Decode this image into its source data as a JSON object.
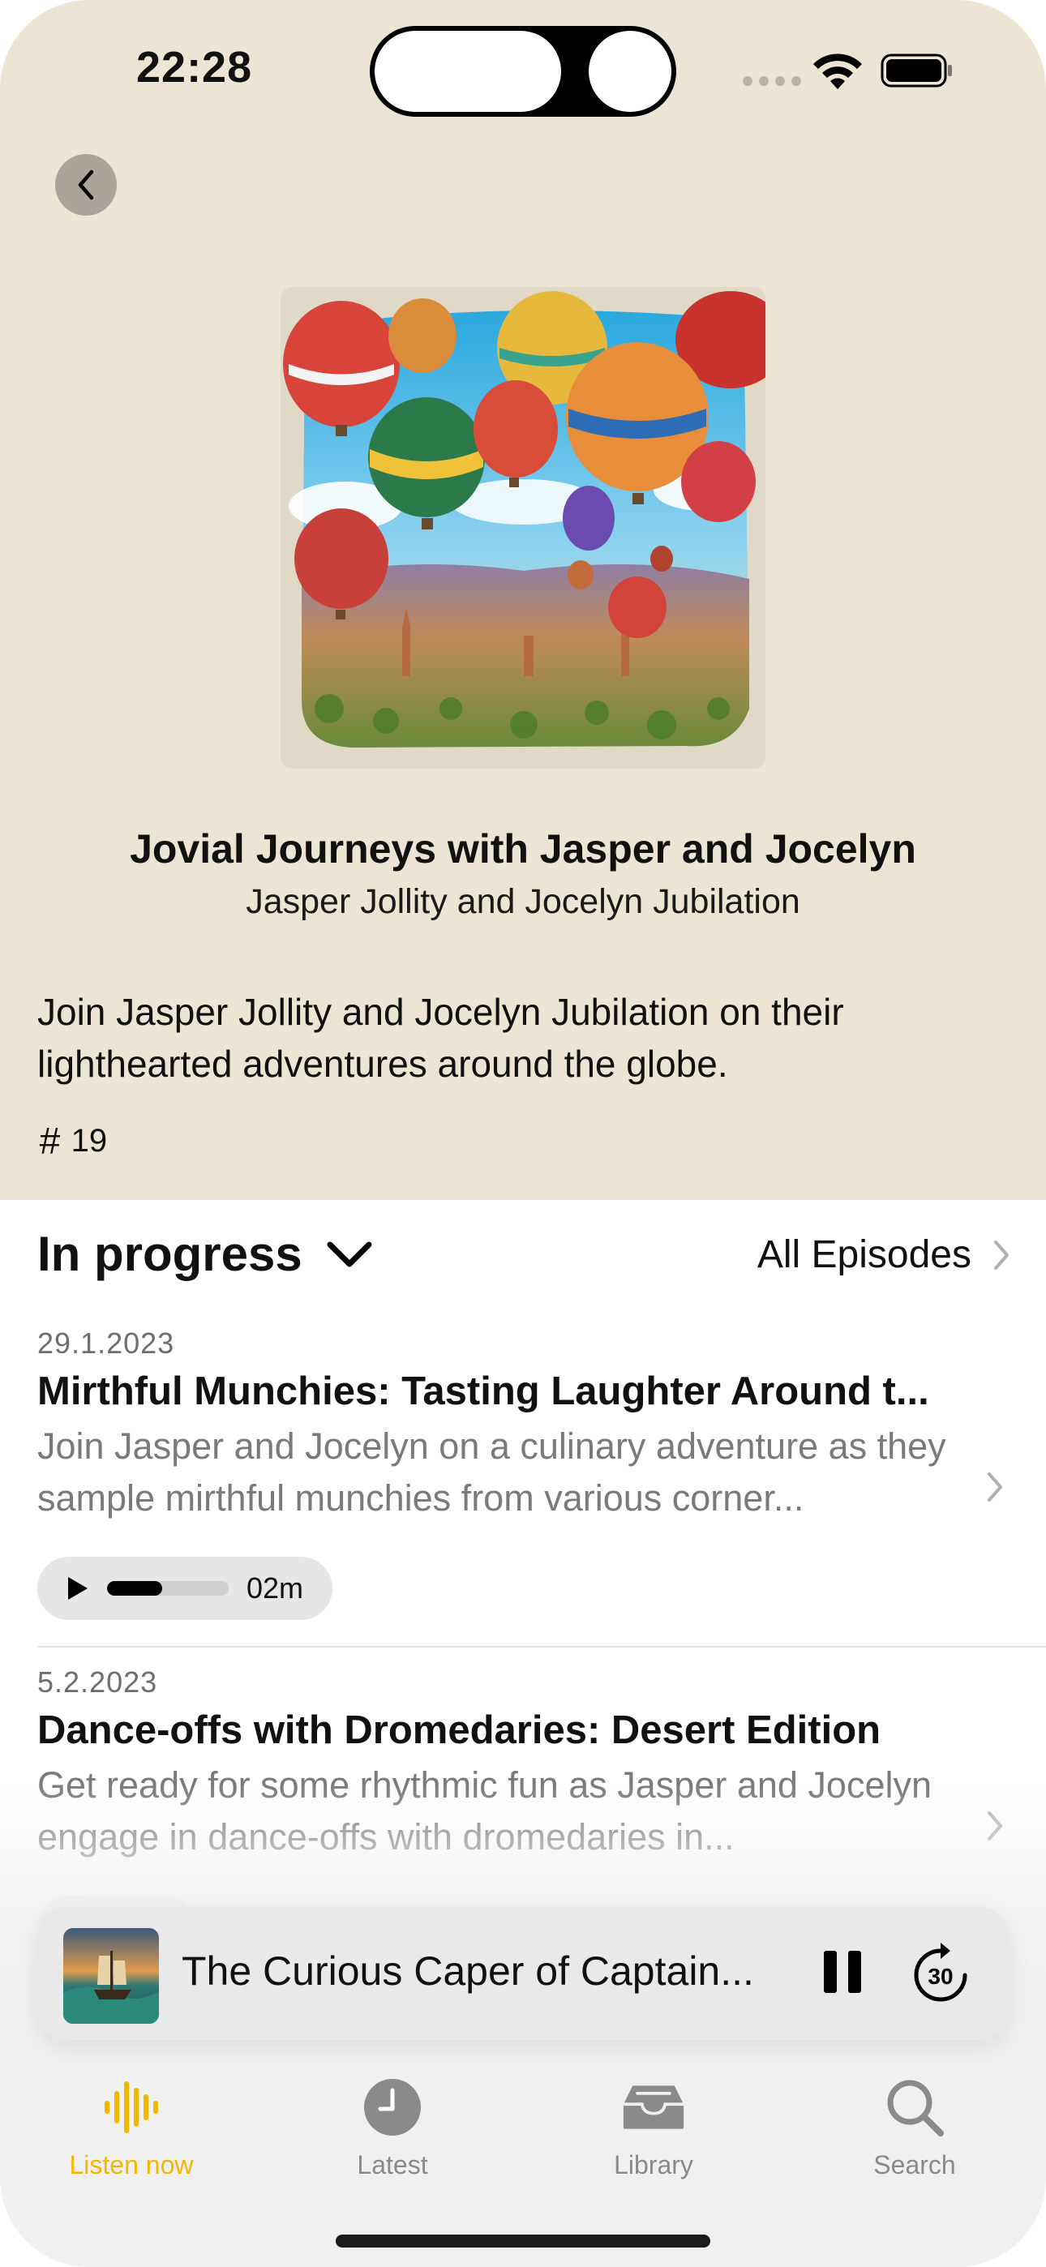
{
  "status_bar": {
    "time": "22:28"
  },
  "podcast": {
    "title": "Jovial Journeys with Jasper and Jocelyn",
    "author": "Jasper Jollity and Jocelyn Jubilation",
    "description": "Join Jasper Jollity and Jocelyn Jubilation on their lighthearted adventures around the globe.",
    "episode_count": "19"
  },
  "list": {
    "section_title": "In progress",
    "all_episodes_label": "All Episodes"
  },
  "episodes": [
    {
      "date": "29.1.2023",
      "title": "Mirthful Munchies: Tasting Laughter Around t...",
      "description": "Join Jasper and Jocelyn on a culinary adventure as they sample mirthful munchies from various corner...",
      "remaining": "02m",
      "progress": 0.45
    },
    {
      "date": "5.2.2023",
      "title": "Dance-offs with Dromedaries: Desert Edition",
      "description": "Get ready for some rhythmic fun as Jasper and Jocelyn engage in dance-offs with dromedaries in...",
      "progress": 0.0
    }
  ],
  "mini_player": {
    "title": "The Curious Caper of Captain...",
    "skip_label": "30"
  },
  "tabs": [
    {
      "label": "Listen now",
      "icon": "waveform-icon",
      "active": true
    },
    {
      "label": "Latest",
      "icon": "clock-icon",
      "active": false
    },
    {
      "label": "Library",
      "icon": "tray-icon",
      "active": false
    },
    {
      "label": "Search",
      "icon": "search-icon",
      "active": false
    }
  ],
  "colors": {
    "header_bg": "#ede5d3",
    "accent": "#f3b600"
  }
}
